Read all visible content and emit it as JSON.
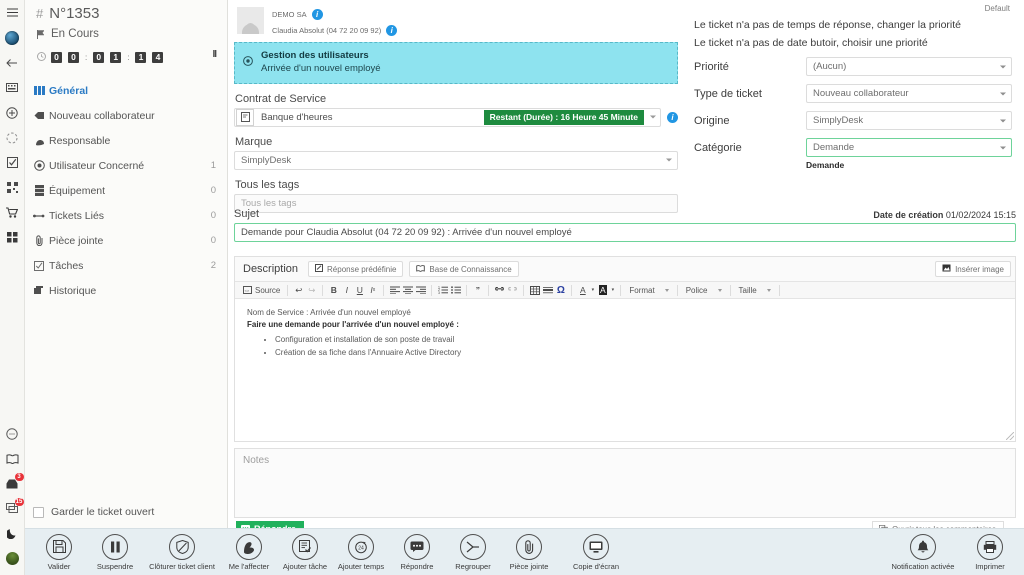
{
  "rail": {
    "items": [
      {
        "name": "menu-icon",
        "badge": null
      },
      {
        "name": "globe-icon",
        "badge": null
      },
      {
        "name": "back-arrow-icon",
        "badge": null
      },
      {
        "name": "keyboard-icon",
        "badge": null
      },
      {
        "name": "add-circle-icon",
        "badge": null
      },
      {
        "name": "refresh-circle-icon",
        "badge": null
      },
      {
        "name": "task-check-icon",
        "badge": null
      },
      {
        "name": "qrcode-icon",
        "badge": null
      },
      {
        "name": "cart-icon",
        "badge": null
      },
      {
        "name": "grid-apps-icon",
        "badge": null
      }
    ],
    "bottom_items": [
      {
        "name": "chat-bubble-icon",
        "badge": null
      },
      {
        "name": "book-icon",
        "badge": null
      },
      {
        "name": "inbox-icon",
        "badge": "3"
      },
      {
        "name": "comments-icon",
        "badge": "15"
      },
      {
        "name": "moon-icon",
        "badge": null
      },
      {
        "name": "user-avatar-icon",
        "badge": null
      }
    ]
  },
  "ticket": {
    "hash": "#",
    "number": "N°1353",
    "status": "En Cours",
    "timer": {
      "digits": [
        "0",
        "0",
        "0",
        "1",
        "1",
        "4"
      ],
      "separator": ":"
    },
    "pause_label": "II",
    "nav": [
      {
        "label": "Général",
        "count": "",
        "icon": "general-icon",
        "active": true
      },
      {
        "label": "Nouveau collaborateur",
        "count": "",
        "icon": "tag-icon",
        "active": false
      },
      {
        "label": "Responsable",
        "count": "",
        "icon": "user-tie-icon",
        "active": false
      },
      {
        "label": "Utilisateur Concerné",
        "count": "1",
        "icon": "target-user-icon",
        "active": false
      },
      {
        "label": "Équipement",
        "count": "0",
        "icon": "server-icon",
        "active": false
      },
      {
        "label": "Tickets Liés",
        "count": "0",
        "icon": "link-icon",
        "active": false
      },
      {
        "label": "Pièce jointe",
        "count": "0",
        "icon": "paperclip-icon",
        "active": false
      },
      {
        "label": "Tâches",
        "count": "2",
        "icon": "checkbox-icon",
        "active": false
      },
      {
        "label": "Historique",
        "count": "",
        "icon": "history-icon",
        "active": false
      }
    ],
    "keep_open_label": "Garder le ticket ouvert"
  },
  "requester": {
    "company": "DEMO SA",
    "contact": "Claudia Absolut (04 72 20 09 92)"
  },
  "service_banner": {
    "title": "Gestion des utilisateurs",
    "subtitle": "Arrivée d'un nouvel employé"
  },
  "center": {
    "contract_label": "Contrat de Service",
    "contract_name": "Banque d'heures",
    "contract_pill": "Restant (Durée) : 16 Heure 45 Minute",
    "marque_label": "Marque",
    "marque_value": "SimplyDesk",
    "tags_label": "Tous les tags",
    "tags_placeholder": "Tous les tags"
  },
  "subject": {
    "label": "Sujet",
    "date_label": "Date de création",
    "date_value": "01/02/2024 15:15",
    "value": "Demande pour Claudia Absolut (04 72 20 09 92) : Arrivée d'un nouvel employé"
  },
  "editor": {
    "title": "Description",
    "btn_predefined": "Réponse prédéfinie",
    "btn_knowledge": "Base de Connaissance",
    "btn_insert_image": "Insérer image",
    "toolbar": {
      "source": "Source",
      "format": "Format",
      "police": "Police",
      "taille": "Taille"
    },
    "body": {
      "line1": "Nom de Service : Arrivée d'un nouvel employé",
      "line2": "Faire une demande pour l'arrivée d'un nouvel employé :",
      "bullets": [
        "Configuration et installation de son poste de travail",
        "Création de sa fiche dans l'Annuaire Active Directory"
      ]
    }
  },
  "notes": {
    "placeholder": "Notes",
    "reply_button": "Répondre",
    "open_comments_button": "Ouvrir tous les commentaires"
  },
  "right": {
    "default_label": "Default",
    "warning1": "Le ticket n'a pas de temps de réponse, changer la priorité",
    "warning2": "Le ticket n'a pas de date butoir, choisir une priorité",
    "fields": [
      {
        "label": "Priorité",
        "value": "(Aucun)",
        "highlight": false
      },
      {
        "label": "Type de ticket",
        "value": "Nouveau collaborateur",
        "highlight": false
      },
      {
        "label": "Origine",
        "value": "SimplyDesk",
        "highlight": false
      },
      {
        "label": "Catégorie",
        "value": "Demande",
        "highlight": true
      }
    ],
    "subcategory": "Demande"
  },
  "bottombar": {
    "left_actions": [
      {
        "label": "Valider",
        "icon": "save-icon"
      },
      {
        "label": "Suspendre",
        "icon": "pause-icon"
      },
      {
        "label": "Clôturer ticket client",
        "icon": "shield-icon"
      },
      {
        "label": "Me l'affecter",
        "icon": "hand-icon"
      },
      {
        "label": "Ajouter tâche",
        "icon": "task-add-icon"
      },
      {
        "label": "Ajouter temps",
        "icon": "clock-24-icon"
      },
      {
        "label": "Répondre",
        "icon": "reply-bubble-icon"
      },
      {
        "label": "Regrouper",
        "icon": "merge-icon"
      },
      {
        "label": "Pièce jointe",
        "icon": "paperclip-icon"
      },
      {
        "label": "Copie d'écran",
        "icon": "screen-icon"
      }
    ],
    "right_actions": [
      {
        "label": "Notification activée",
        "icon": "bell-icon"
      },
      {
        "label": "Imprimer",
        "icon": "printer-icon"
      }
    ]
  },
  "colors": {
    "accent_blue": "#2a7ac4",
    "banner_cyan": "#8ee3ef",
    "pill_green": "#1e8b3f",
    "reply_green": "#21b15c",
    "badge_red": "#e8333a",
    "bottombar_bg": "#e6eef2"
  }
}
